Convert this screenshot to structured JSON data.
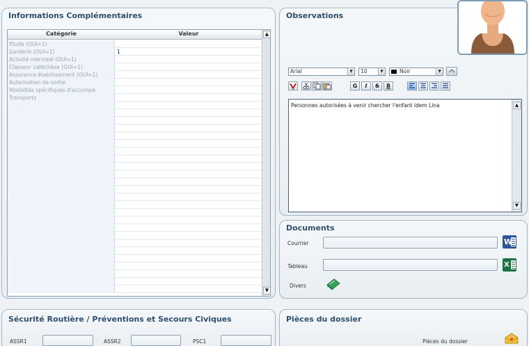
{
  "info_panel": {
    "title": "Informations Complémentaires",
    "columns": [
      "Catégorie",
      "Valeur"
    ],
    "rows": [
      {
        "category": "Etude (OUI=1)",
        "value": ""
      },
      {
        "category": "Garderie (OUI=1)",
        "value": "1"
      },
      {
        "category": "Activité mercredi (OUI=1)",
        "value": ""
      },
      {
        "category": "Classeur catéchèse (OUI=1)",
        "value": ""
      },
      {
        "category": "Assurance établissement (OUI=1)",
        "value": ""
      },
      {
        "category": "Autorisation de sortie",
        "value": ""
      },
      {
        "category": "Modalités spécifiques d'accompa",
        "value": ""
      },
      {
        "category": "Transports",
        "value": ""
      }
    ],
    "scroll_up": "▲",
    "scroll_down": "▼"
  },
  "observations": {
    "title": "Observations",
    "font_name": "Arial",
    "font_size": "10",
    "color_label": "Noir",
    "dropdown_glyph": "▼",
    "format_buttons": [
      "G",
      "I",
      "S",
      "B"
    ],
    "text": "Personnes autorisées à venir chercher l'enfant idem Lina",
    "scroll_up": "▲",
    "scroll_down": "▼"
  },
  "documents": {
    "title": "Documents",
    "courrier_label": "Courrier",
    "courrier_value": "",
    "tableau_label": "Tableau",
    "tableau_value": "",
    "divers_label": "Divers",
    "word_letter": "W",
    "excel_letter": "X"
  },
  "securite": {
    "title": "Sécurité Routière / Préventions et Secours Civiques",
    "assr1_label": "ASSR1",
    "assr2_label": "ASSR2",
    "psc1_label": "PSC1"
  },
  "pieces": {
    "title": "Pièces du dossier",
    "button_label": "Pièces du dossier"
  },
  "colors": {
    "title": "#2f4f6e",
    "panel_border": "#9fb4c6",
    "grid_category_bg": "#eef4fa",
    "word_blue": "#2b5797",
    "excel_green": "#1e7145"
  }
}
